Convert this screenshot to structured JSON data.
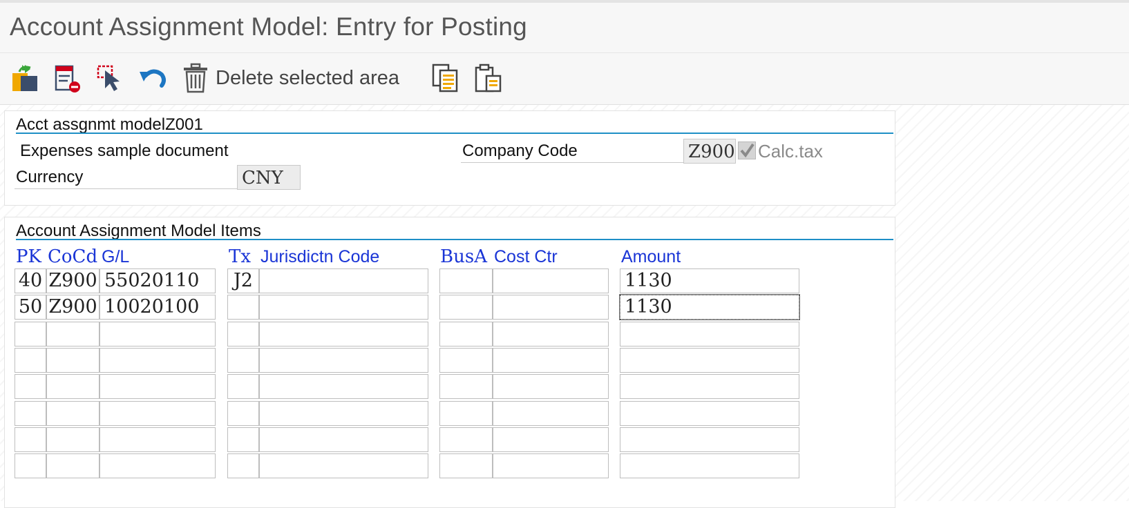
{
  "window": {
    "title": "Account Assignment Model: Entry for Posting"
  },
  "toolbar": {
    "buttons": [
      {
        "icon": "copy-paste-icon"
      },
      {
        "icon": "delete-row-icon"
      },
      {
        "icon": "select-pointer-icon"
      },
      {
        "icon": "undo-icon"
      },
      {
        "icon": "trash-icon",
        "label": "Delete selected area"
      },
      {
        "icon": "copy-document-icon"
      },
      {
        "icon": "paste-clipboard-icon"
      }
    ]
  },
  "header_panel": {
    "title": "Acct assgnmt modelZ001",
    "description": "Expenses sample document",
    "company_code_label": "Company Code",
    "company_code_value": "Z900",
    "calc_tax_label": "Calc.tax",
    "calc_tax_checked": true,
    "currency_label": "Currency",
    "currency_value": "CNY"
  },
  "items_panel": {
    "title": "Account Assignment Model Items",
    "columns": {
      "pk": "PK",
      "cocd": "CoCd",
      "gl": "G/L",
      "tx": "Tx",
      "jurisdiction": "Jurisdictn Code",
      "busa": "BusA",
      "cost_ctr": "Cost Ctr",
      "amount": "Amount"
    },
    "rows": [
      {
        "pk": "40",
        "cocd": "Z900",
        "gl": "55020110",
        "tx": "J2",
        "jurisdiction": "",
        "busa": "",
        "cost_ctr": "",
        "amount": "1130"
      },
      {
        "pk": "50",
        "cocd": "Z900",
        "gl": "10020100",
        "tx": "",
        "jurisdiction": "",
        "busa": "",
        "cost_ctr": "",
        "amount": "1130"
      },
      {
        "pk": "",
        "cocd": "",
        "gl": "",
        "tx": "",
        "jurisdiction": "",
        "busa": "",
        "cost_ctr": "",
        "amount": ""
      },
      {
        "pk": "",
        "cocd": "",
        "gl": "",
        "tx": "",
        "jurisdiction": "",
        "busa": "",
        "cost_ctr": "",
        "amount": ""
      },
      {
        "pk": "",
        "cocd": "",
        "gl": "",
        "tx": "",
        "jurisdiction": "",
        "busa": "",
        "cost_ctr": "",
        "amount": ""
      },
      {
        "pk": "",
        "cocd": "",
        "gl": "",
        "tx": "",
        "jurisdiction": "",
        "busa": "",
        "cost_ctr": "",
        "amount": ""
      },
      {
        "pk": "",
        "cocd": "",
        "gl": "",
        "tx": "",
        "jurisdiction": "",
        "busa": "",
        "cost_ctr": "",
        "amount": ""
      },
      {
        "pk": "",
        "cocd": "",
        "gl": "",
        "tx": "",
        "jurisdiction": "",
        "busa": "",
        "cost_ctr": "",
        "amount": ""
      }
    ],
    "focused_cell": {
      "row": 1,
      "column": "amount"
    }
  },
  "colors": {
    "accent_rule": "#1e8fc6",
    "column_header": "#1a35d6",
    "icon_blue": "#1d76c2",
    "icon_red": "#d0021b",
    "icon_gold": "#f0a800"
  }
}
